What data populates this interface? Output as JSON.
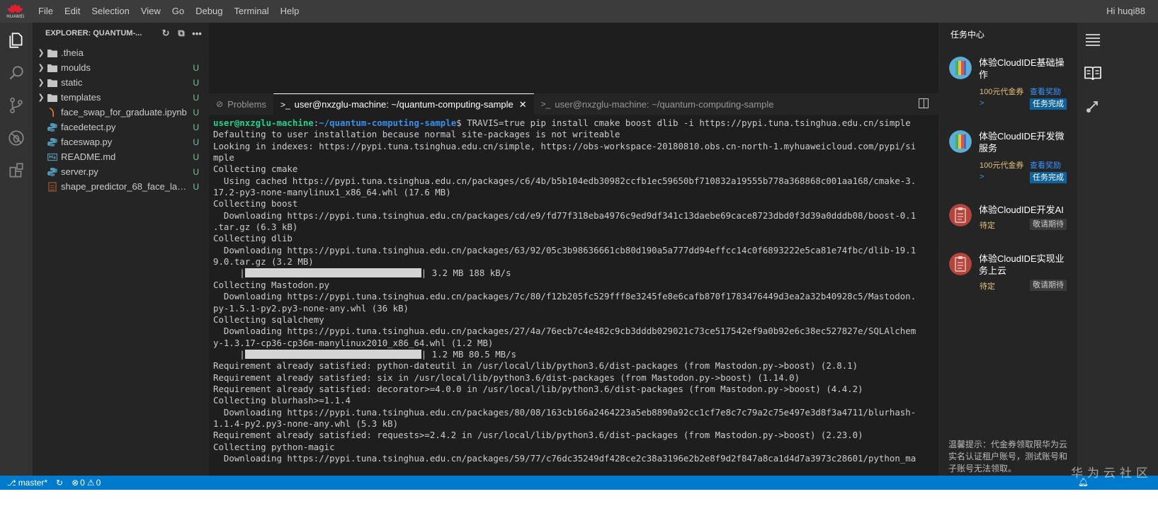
{
  "brand": {
    "logo_text": "HUAWEI"
  },
  "menu": [
    "File",
    "Edit",
    "Selection",
    "View",
    "Go",
    "Debug",
    "Terminal",
    "Help"
  ],
  "user_greeting": "Hi huqi88",
  "activity_icons": [
    "files-icon",
    "search-icon",
    "source-control-icon",
    "debug-icon",
    "extensions-icon"
  ],
  "explorer": {
    "title": "EXPLORER: QUANTUM-...",
    "items": [
      {
        "name": ".theia",
        "type": "folder",
        "status": ""
      },
      {
        "name": "moulds",
        "type": "folder",
        "status": "U"
      },
      {
        "name": "static",
        "type": "folder",
        "status": "U"
      },
      {
        "name": "templates",
        "type": "folder",
        "status": "U"
      },
      {
        "name": "face_swap_for_graduate.ipynb",
        "type": "notebook",
        "status": "U"
      },
      {
        "name": "facedetect.py",
        "type": "python",
        "status": "U"
      },
      {
        "name": "faceswap.py",
        "type": "python",
        "status": "U"
      },
      {
        "name": "README.md",
        "type": "markdown",
        "status": "U"
      },
      {
        "name": "server.py",
        "type": "python",
        "status": "U"
      },
      {
        "name": "shape_predictor_68_face_land...",
        "type": "data",
        "status": "U"
      }
    ]
  },
  "panel": {
    "tabs": [
      {
        "label": "Problems",
        "icon": "problems-icon",
        "active": false
      },
      {
        "label": "user@nxzglu-machine: ~/quantum-computing-sample",
        "icon": "terminal-icon",
        "active": true
      },
      {
        "label": "user@nxzglu-machine: ~/quantum-computing-sample",
        "icon": "terminal-icon",
        "active": false
      }
    ]
  },
  "terminal": {
    "prompt_user": "user@nxzglu-machine",
    "prompt_path": "~/quantum-computing-sample",
    "command": "$ TRAVIS=true pip install cmake boost dlib -i https://pypi.tuna.tsinghua.edu.cn/simple",
    "lines": [
      "Defaulting to user installation because normal site-packages is not writeable",
      "Looking in indexes: https://pypi.tuna.tsinghua.edu.cn/simple, https://obs-workspace-20180810.obs.cn-north-1.myhuaweicloud.com/pypi/si",
      "mple",
      "Collecting cmake",
      "  Using cached https://pypi.tuna.tsinghua.edu.cn/packages/c6/4b/b5b104edb30982ccfb1ec59650bf710832a19555b778a368868c001aa168/cmake-3.",
      "17.2-py3-none-manylinux1_x86_64.whl (17.6 MB)",
      "Collecting boost",
      "  Downloading https://pypi.tuna.tsinghua.edu.cn/packages/cd/e9/fd77f318eba4976c9ed9df341c13daebe69cace8723dbd0f3d39a0dddb08/boost-0.1",
      ".tar.gz (6.3 kB)",
      "Collecting dlib",
      "  Downloading https://pypi.tuna.tsinghua.edu.cn/packages/63/92/05c3b98636661cb80d190a5a777dd94effcc14c0f6893222e5ca81e74fbc/dlib-19.1",
      "9.0.tar.gz (3.2 MB)",
      {
        "progress": 1.0,
        "text": "3.2 MB 188 kB/s"
      },
      "Collecting Mastodon.py",
      "  Downloading https://pypi.tuna.tsinghua.edu.cn/packages/7c/80/f12b205fc529fff8e3245fe8e6cafb870f1783476449d3ea2a32b40928c5/Mastodon.",
      "py-1.5.1-py2.py3-none-any.whl (36 kB)",
      "Collecting sqlalchemy",
      "  Downloading https://pypi.tuna.tsinghua.edu.cn/packages/27/4a/76ecb7c4e482c9cb3dddb029021c73ce517542ef9a0b92e6c38ec527827e/SQLAlchem",
      "y-1.3.17-cp36-cp36m-manylinux2010_x86_64.whl (1.2 MB)",
      {
        "progress": 1.0,
        "text": "1.2 MB 80.5 MB/s"
      },
      "Requirement already satisfied: python-dateutil in /usr/local/lib/python3.6/dist-packages (from Mastodon.py->boost) (2.8.1)",
      "Requirement already satisfied: six in /usr/local/lib/python3.6/dist-packages (from Mastodon.py->boost) (1.14.0)",
      "Requirement already satisfied: decorator>=4.0.0 in /usr/local/lib/python3.6/dist-packages (from Mastodon.py->boost) (4.4.2)",
      "Collecting blurhash>=1.1.4",
      "  Downloading https://pypi.tuna.tsinghua.edu.cn/packages/80/08/163cb166a2464223a5eb8890a92cc1cf7e8c7c79a2c75e497e3d8f3a4711/blurhash-",
      "1.1.4-py2.py3-none-any.whl (5.3 kB)",
      "Requirement already satisfied: requests>=2.4.2 in /usr/local/lib/python3.6/dist-packages (from Mastodon.py->boost) (2.23.0)",
      "Collecting python-magic",
      "  Downloading https://pypi.tuna.tsinghua.edu.cn/packages/59/77/c76dc35249df428ce2c38a3196e2b2e8f9d2f847a8ca1d4d7a3973c28601/python_ma"
    ]
  },
  "task_center": {
    "title": "任务中心",
    "tasks": [
      {
        "name": "体验CloudIDE基础操作",
        "reward": "100元代金券",
        "link": "查看奖励",
        "arrow": ">",
        "state": "任务完成",
        "kind": "done"
      },
      {
        "name": "体验CloudIDE开发微服务",
        "reward": "100元代金券",
        "link": "查看奖励",
        "arrow": ">",
        "state": "任务完成",
        "kind": "done"
      },
      {
        "name": "体验CloudIDE开发AI",
        "reward": "待定",
        "link": "",
        "arrow": "",
        "state": "敬请期待",
        "kind": "pending"
      },
      {
        "name": "体验CloudIDE实现业务上云",
        "reward": "待定",
        "link": "",
        "arrow": "",
        "state": "敬请期待",
        "kind": "pending"
      }
    ],
    "notice": "温馨提示：代金券领取限华为云实名认证租户账号，测试账号和子账号无法领取。"
  },
  "statusbar": {
    "branch": "master*",
    "errors": "0",
    "warnings": "0"
  },
  "watermark": "华为云社区",
  "colors": {
    "accent": "#007acc",
    "git_untracked": "#73c991",
    "prompt_user": "#23d18b",
    "prompt_path": "#3b8eea"
  }
}
